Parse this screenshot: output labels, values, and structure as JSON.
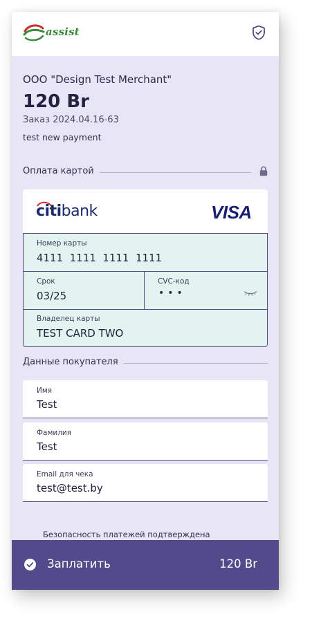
{
  "header": {
    "logo_text": "assist"
  },
  "payment": {
    "merchant": "OOO \"Design Test Merchant\"",
    "amount": "120 Br",
    "order_label": "Заказ",
    "order_number": "2024.04.16-63",
    "description": "test new payment"
  },
  "card_section": {
    "title": "Оплата картой",
    "bank_name_bold": "citi",
    "bank_name_rest": "bank",
    "network": "VISA",
    "card_number_label": "Номер карты",
    "card_number_value": "4111  1111  1111  1111",
    "expiry_label": "Срок",
    "expiry_value": "03/25",
    "cvc_label": "CVC-код",
    "cvc_value": "•••",
    "holder_label": "Владелец карты",
    "holder_value": "TEST CARD TWO"
  },
  "buyer_section": {
    "title": "Данные покупателя",
    "first_name_label": "Имя",
    "first_name_value": "Test",
    "last_name_label": "Фамилия",
    "last_name_value": "Test",
    "email_label": "Email для чека",
    "email_value": "test@test.by"
  },
  "footer": {
    "security_note": "Безопасность платежей подтверждена",
    "pay_label": "Заплатить",
    "pay_amount": "120 Br"
  },
  "colors": {
    "page_bg": "#e8e5f6",
    "card_fields_bg": "#e2f3f0",
    "accent": "#524a8a",
    "visa": "#1a1f71",
    "citi": "#1b2a6b"
  }
}
